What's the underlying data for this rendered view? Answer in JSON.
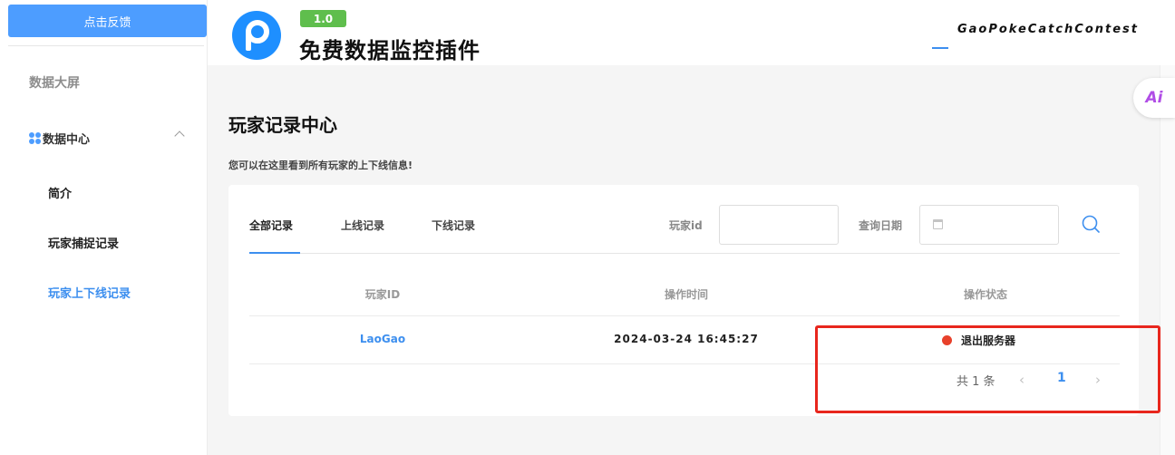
{
  "sidebar": {
    "feedback_button": "点击反馈",
    "dashboard": "数据大屏",
    "data_center": "数据中心",
    "items": [
      {
        "label": "简介"
      },
      {
        "label": "玩家捕捉记录"
      },
      {
        "label": "玩家上下线记录"
      }
    ]
  },
  "header": {
    "version": "1.0",
    "product_title": "免费数据监控插件",
    "brand": "GaoPokeCatchContest"
  },
  "page": {
    "title": "玩家记录中心",
    "subtitle": "您可以在这里看到所有玩家的上下线信息!"
  },
  "tabs": [
    {
      "label": "全部记录",
      "active": true
    },
    {
      "label": "上线记录",
      "active": false
    },
    {
      "label": "下线记录",
      "active": false
    }
  ],
  "filters": {
    "player_id_label": "玩家id",
    "player_id_value": "",
    "date_label": "查询日期",
    "date_value": ""
  },
  "table": {
    "headers": [
      "玩家ID",
      "操作时间",
      "操作状态"
    ],
    "rows": [
      {
        "player_id": "LaoGao",
        "time": "2024-03-24 16:45:27",
        "status": "退出服务器"
      }
    ]
  },
  "pagination": {
    "total": "共 1 条",
    "prev": "‹",
    "current": "1",
    "next": "›"
  },
  "floating": {
    "ai_label": "Ai"
  },
  "colors": {
    "accent": "#3d8fef",
    "status_offline": "#e8412b",
    "highlight": "#e8261d"
  }
}
